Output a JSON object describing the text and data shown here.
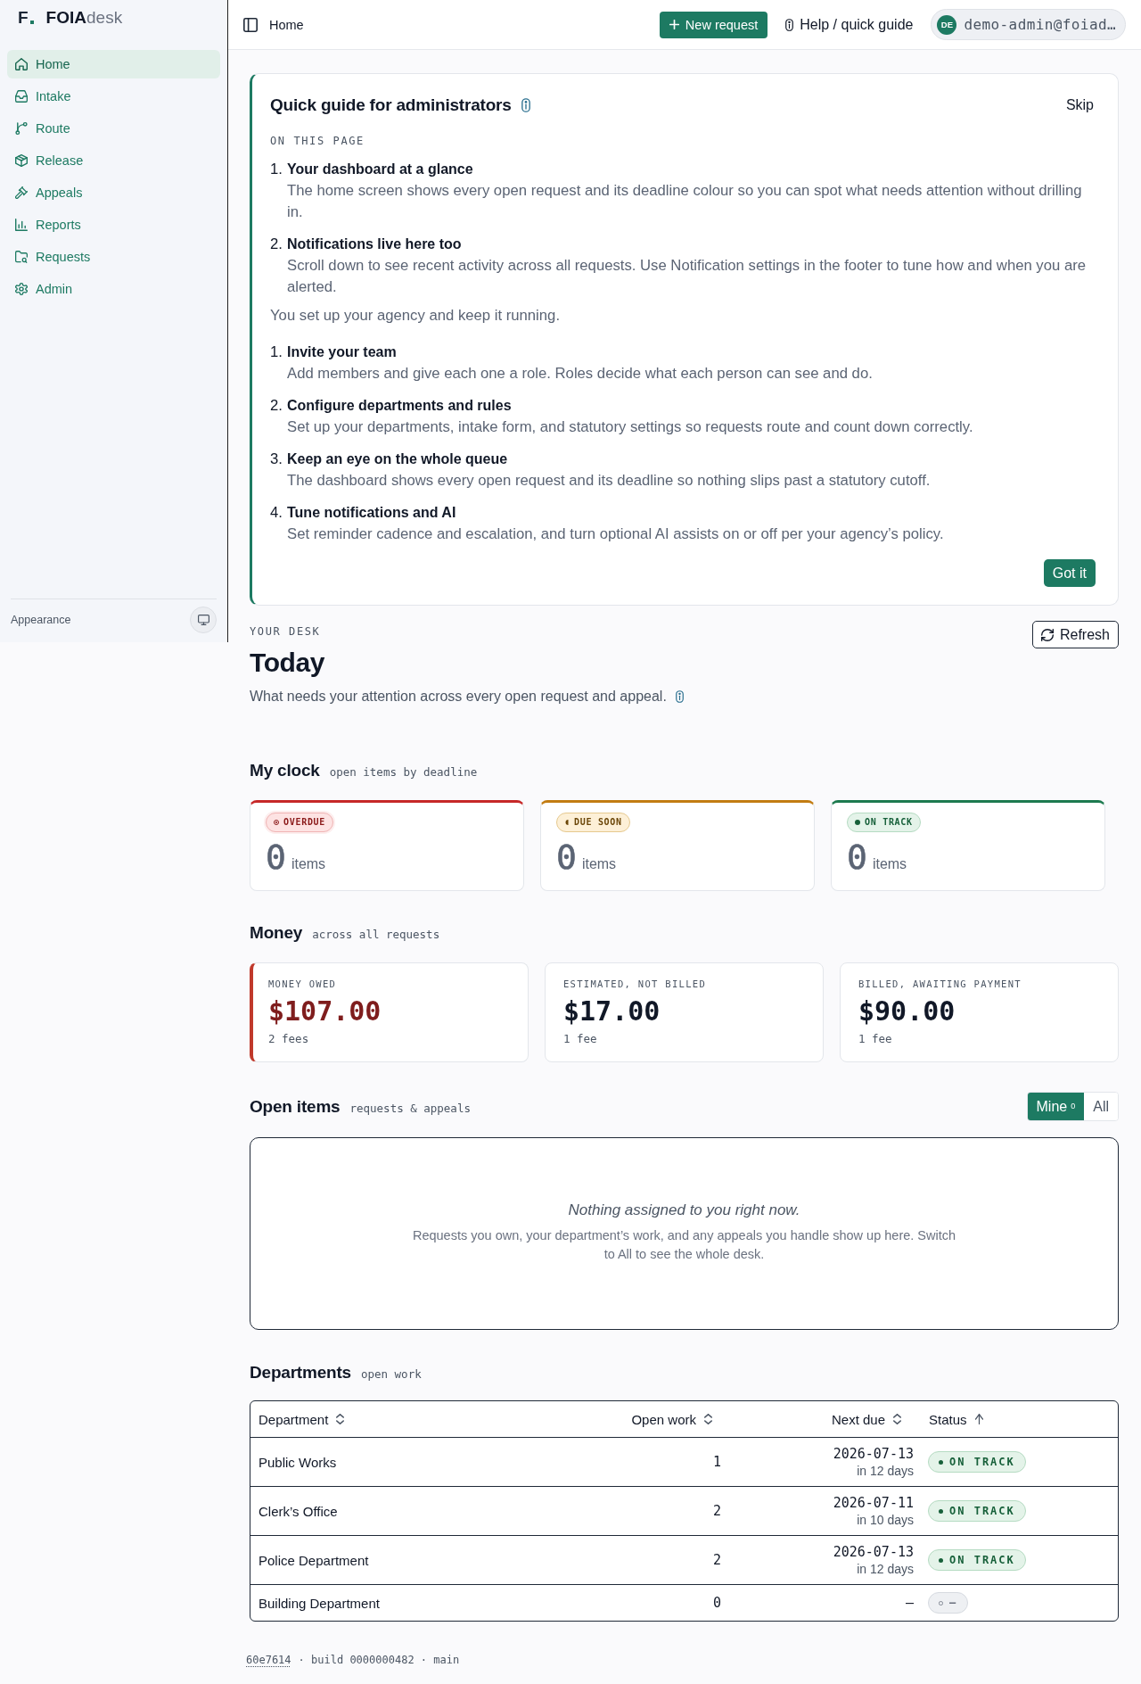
{
  "sidebar": {
    "logo": {
      "mark": "F",
      "name": "**FOIA**desk"
    },
    "items": [
      {
        "label": "Home",
        "selected": true
      },
      {
        "label": "Intake",
        "selected": false
      },
      {
        "label": "Route",
        "selected": false
      },
      {
        "label": "Release",
        "selected": false
      },
      {
        "label": "Appeals",
        "selected": false
      },
      {
        "label": "Reports",
        "selected": false
      },
      {
        "label": "Requests",
        "selected": false
      },
      {
        "label": "Admin",
        "selected": false
      }
    ],
    "appearance": {
      "label": "Appearance"
    }
  },
  "header": {
    "breadcrumb": "Home",
    "new_request": "New request",
    "help": "Help / quick guide",
    "user": {
      "initials": "DE",
      "email": "demo-admin@foiad…"
    }
  },
  "guide": {
    "title": "Quick guide for administrators",
    "skip": "Skip",
    "section_label": "ON THIS PAGE",
    "page_steps": [
      {
        "number": "1.",
        "title": "Your dashboard at a glance",
        "text": "The home screen shows every open request and its deadline colour so you can spot what needs attention without drilling in."
      },
      {
        "number": "2.",
        "title": "Notifications live here too",
        "text": "Scroll down to see recent activity across all requests. Use Notification settings in the footer to tune how and when you are alerted."
      }
    ],
    "intro": "You set up your agency and keep it running.",
    "role_steps": [
      {
        "number": "1.",
        "title": "Invite your team",
        "text": "Add members and give each one a role. Roles decide what each person can see and do."
      },
      {
        "number": "2.",
        "title": "Configure departments and rules",
        "text": "Set up your departments, intake form, and statutory settings so requests route and count down correctly."
      },
      {
        "number": "3.",
        "title": "Keep an eye on the whole queue",
        "text": "The dashboard shows every open request and its deadline so nothing slips past a statutory cutoff."
      },
      {
        "number": "4.",
        "title": "Tune notifications and AI",
        "text": "Set reminder cadence and escalation, and turn optional AI assists on or off per your agency’s policy."
      }
    ],
    "confirm": "Got it"
  },
  "desk": {
    "eyebrow": "YOUR DESK",
    "title": "Today",
    "description": "What needs your attention across every open request and appeal.",
    "refresh": "Refresh"
  },
  "clock": {
    "title": "My clock",
    "subtitle": "open items by deadline",
    "cards": [
      {
        "kind": "overdue",
        "badge": "OVERDUE",
        "count": "0",
        "unit": "items"
      },
      {
        "kind": "due_soon",
        "badge": "DUE SOON",
        "count": "0",
        "unit": "items"
      },
      {
        "kind": "on_track",
        "badge": "ON TRACK",
        "count": "0",
        "unit": "items"
      }
    ]
  },
  "money": {
    "title": "Money",
    "subtitle": "across all requests",
    "cards": [
      {
        "label": "MONEY OWED",
        "amount": "$107.00",
        "note": "2 fees",
        "highlight": true
      },
      {
        "label": "ESTIMATED, NOT BILLED",
        "amount": "$17.00",
        "note": "1 fee",
        "highlight": false
      },
      {
        "label": "BILLED, AWAITING PAYMENT",
        "amount": "$90.00",
        "note": "1 fee",
        "highlight": false
      }
    ]
  },
  "open_items": {
    "title": "Open items",
    "subtitle": "requests & appeals",
    "filters": [
      {
        "label": "Mine",
        "count": "0",
        "selected": true
      },
      {
        "label": "All",
        "selected": false
      }
    ],
    "empty": {
      "title": "Nothing assigned to you right now.",
      "text": "Requests you own, your department’s work, and any appeals you handle show up here. Switch to All to see the whole desk."
    }
  },
  "departments": {
    "title": "Departments",
    "subtitle": "open work",
    "table": {
      "columns": [
        {
          "label": "Department",
          "sorted": false
        },
        {
          "label": "Open work",
          "sorted": false
        },
        {
          "label": "Next due",
          "sorted": false
        },
        {
          "label": "Status",
          "sorted": true
        }
      ],
      "rows": [
        {
          "department": "Public Works",
          "open_work": "1",
          "next_due": "2026-07-13",
          "due_in": "in 12 days",
          "status": {
            "label": "ON TRACK",
            "kind": "on_track"
          }
        },
        {
          "department": "Clerk’s Office",
          "open_work": "2",
          "next_due": "2026-07-11",
          "due_in": "in 10 days",
          "status": {
            "label": "ON TRACK",
            "kind": "on_track"
          }
        },
        {
          "department": "Police Department",
          "open_work": "2",
          "next_due": "2026-07-13",
          "due_in": "in 12 days",
          "status": {
            "label": "ON TRACK",
            "kind": "on_track"
          }
        },
        {
          "department": "Building Department",
          "open_work": "0",
          "next_due": "—",
          "status": {
            "label": "—",
            "kind": "none"
          }
        }
      ]
    }
  },
  "footer": {
    "commit": "60e7614",
    "details": "· build 0000000482 · main"
  }
}
